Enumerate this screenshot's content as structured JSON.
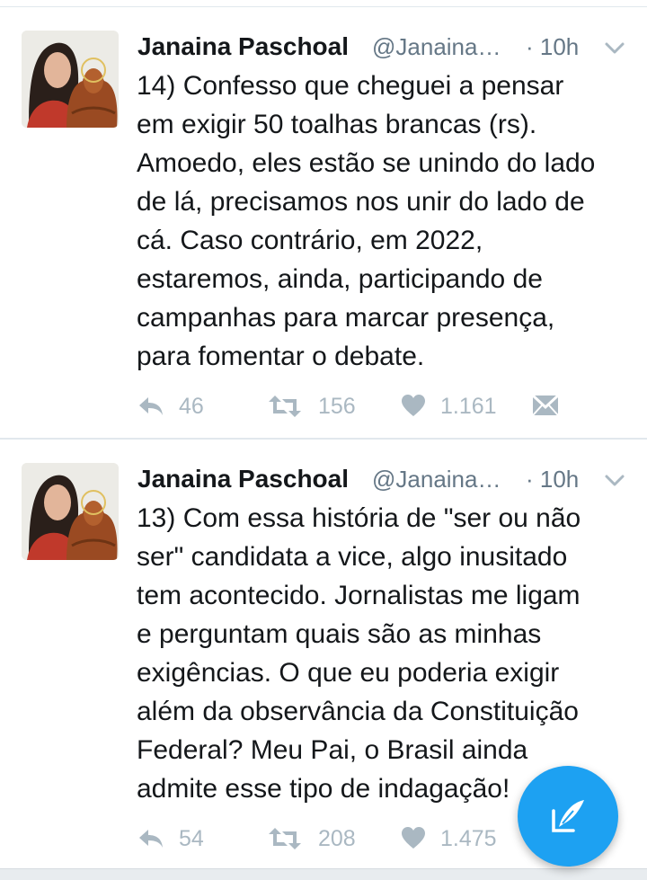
{
  "colors": {
    "text": "#14171a",
    "muted": "#657786",
    "action": "#aab8c2",
    "accent": "#1da1f2",
    "divider": "#e1e8ed"
  },
  "tweets": [
    {
      "author_name": "Janaina Paschoal",
      "handle": "@JanainaD…",
      "time": "· 10h",
      "text": "14) Confesso que cheguei a pensar\nem exigir 50 toalhas brancas (rs).\nAmoedo, eles estão se unindo do lado\nde lá, precisamos nos unir do lado de\ncá. Caso contrário, em 2022,\nestaremos, ainda, participando de\ncampanhas para marcar presença,\npara fomentar o debate.",
      "replies": "46",
      "retweets": "156",
      "likes": "1.161"
    },
    {
      "author_name": "Janaina Paschoal",
      "handle": "@JanainaD…",
      "time": "· 10h",
      "text": "13) Com essa história de \"ser ou não\nser\" candidata a vice, algo inusitado\ntem acontecido. Jornalistas me ligam\ne perguntam quais são as minhas\nexigências. O que eu poderia exigir\nalém da observância da Constituição\nFederal? Meu Pai, o Brasil ainda\nadmite esse tipo de indagação!",
      "replies": "54",
      "retweets": "208",
      "likes": "1.475"
    }
  ],
  "icons": {
    "reply": "reply-icon",
    "retweet": "retweet-icon",
    "like": "heart-icon",
    "dm": "envelope-icon",
    "caret": "chevron-down-icon",
    "compose": "compose-tweet-icon"
  }
}
